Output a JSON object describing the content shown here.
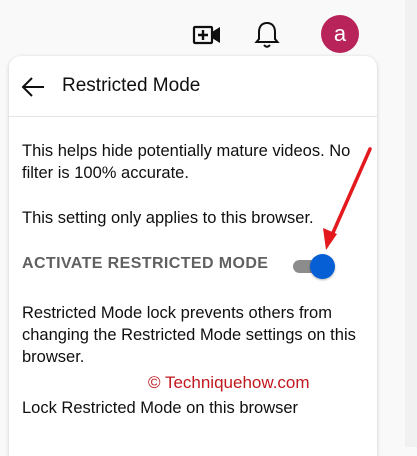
{
  "header": {
    "create_icon": "video-camera-plus-icon",
    "notifications_icon": "bell-icon",
    "avatar_letter": "a",
    "avatar_color": "#b8235a"
  },
  "panel": {
    "back_icon": "arrow-left-icon",
    "title": "Restricted Mode",
    "description": "This helps hide potentially mature videos. No filter is 100% accurate.",
    "browser_note": "This setting only applies to this browser.",
    "toggle_label": "ACTIVATE RESTRICTED MODE",
    "toggle_on": true,
    "toggle_color": "#065fd4",
    "lock_description": "Restricted Mode lock prevents others from changing the Restricted Mode settings on this browser.",
    "lock_label": "Lock Restricted Mode on this browser"
  },
  "watermark": "© Techniquehow.com",
  "annotation_color": "#e4191e"
}
